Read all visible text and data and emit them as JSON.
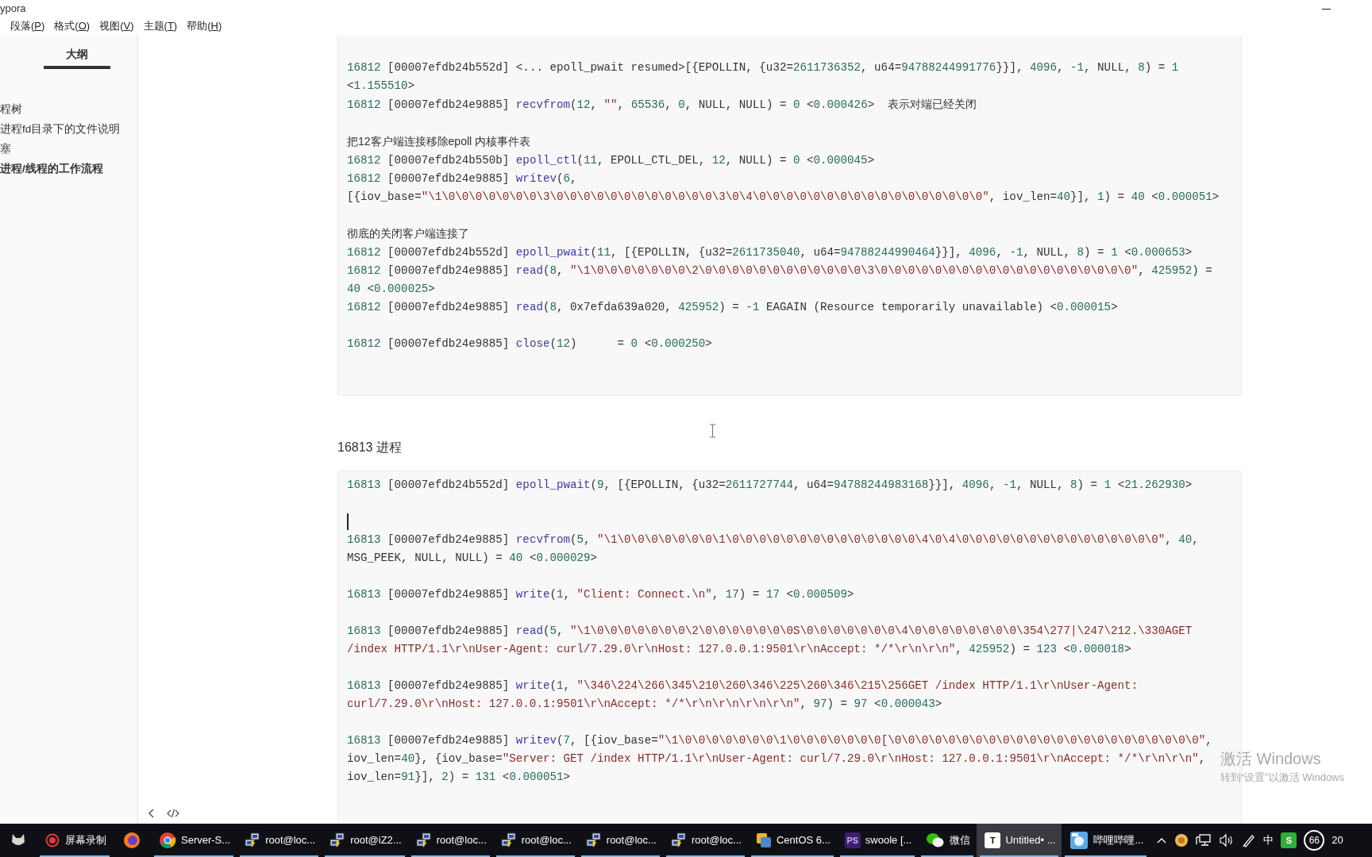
{
  "window": {
    "title": "ypora"
  },
  "menu": [
    {
      "text": "段落(",
      "mnemonic": "P",
      "tail": ")"
    },
    {
      "text": "格式(",
      "mnemonic": "O",
      "tail": ")"
    },
    {
      "text": "视图(",
      "mnemonic": "V",
      "tail": ")"
    },
    {
      "text": "主题(",
      "mnemonic": "T",
      "tail": ")"
    },
    {
      "text": "帮助(",
      "mnemonic": "H",
      "tail": ")"
    }
  ],
  "outline": {
    "title": "大纲",
    "items": [
      {
        "text": "程树",
        "selected": false
      },
      {
        "text": "进程fd目录下的文件说明",
        "selected": false
      },
      {
        "text": "塞",
        "selected": false
      },
      {
        "text": "进程/线程的工作流程",
        "selected": true
      }
    ]
  },
  "document": {
    "blocks": [
      {
        "kind": "code",
        "cut_top": true,
        "groups": [
          {
            "lines": [
              {
                "kind": "code",
                "text": "16812 [00007efdb24b552d] <... epoll_pwait resumed>[{EPOLLIN, {u32=2611736352, u64=94788244991776}}], 4096, -1, NULL, 8) = 1 <1.155510>"
              },
              {
                "kind": "code",
                "text": "16812 [00007efdb24e9885] recvfrom(12, \"\", 65536, 0, NULL, NULL) = 0 <0.000426>",
                "note": "表示对端已经关闭"
              }
            ]
          },
          {
            "lines": [
              {
                "kind": "prose",
                "text": "把12客户端连接移除epoll 内核事件表"
              },
              {
                "kind": "code",
                "text": "16812 [00007efdb24b550b] epoll_ctl(11, EPOLL_CTL_DEL, 12, NULL) = 0 <0.000045>"
              },
              {
                "kind": "code",
                "text": "16812 [00007efdb24e9885] writev(6, [{iov_base=\"\\1\\0\\0\\0\\0\\0\\0\\0\\3\\0\\0\\0\\0\\0\\0\\0\\0\\0\\0\\0\\0\\3\\0\\4\\0\\0\\0\\0\\0\\0\\0\\0\\0\\0\\0\\0\\0\\0\\0\\0\\0\", iov_len=40}], 1) = 40 <0.000051>"
              }
            ]
          },
          {
            "lines": [
              {
                "kind": "prose",
                "text": "彻底的关闭客户端连接了"
              },
              {
                "kind": "code",
                "text": "16812 [00007efdb24b552d] epoll_pwait(11, [{EPOLLIN, {u32=2611735040, u64=94788244990464}}], 4096, -1, NULL, 8) = 1 <0.000653>"
              },
              {
                "kind": "code",
                "text": "16812 [00007efdb24e9885] read(8, \"\\1\\0\\0\\0\\0\\0\\0\\0\\2\\0\\0\\0\\0\\0\\0\\0\\0\\0\\0\\0\\0\\3\\0\\0\\0\\0\\0\\0\\0\\0\\0\\0\\0\\0\\0\\0\\0\\0\\0\\0\\0\", 425952) = 40 <0.000025>"
              },
              {
                "kind": "code",
                "text": "16812 [00007efdb24e9885] read(8, 0x7efda639a020, 425952) = -1 EAGAIN (Resource temporarily unavailable) <0.000015>"
              }
            ]
          },
          {
            "lines": [
              {
                "kind": "code",
                "text": "16812 [00007efdb24e9885] close(12)      = 0 <0.000250>"
              }
            ]
          }
        ]
      },
      {
        "kind": "heading",
        "text": "16813 进程"
      },
      {
        "kind": "code",
        "cut_top": false,
        "groups": [
          {
            "lines": [
              {
                "kind": "code",
                "text": "16813 [00007efdb24b552d] epoll_pwait(9, [{EPOLLIN, {u32=2611727744, u64=94788244983168}}], 4096, -1, NULL, 8) = 1 <21.262930>"
              }
            ]
          },
          {
            "lines": [
              {
                "kind": "cursor"
              },
              {
                "kind": "code",
                "text": "16813 [00007efdb24e9885] recvfrom(5, \"\\1\\0\\0\\0\\0\\0\\0\\0\\1\\0\\0\\0\\0\\0\\0\\0\\0\\0\\0\\0\\0\\0\\0\\4\\0\\4\\0\\0\\0\\0\\0\\0\\0\\0\\0\\0\\0\\0\\0\\0\\0\", 40, MSG_PEEK, NULL, NULL) = 40 <0.000029>"
              }
            ]
          },
          {
            "lines": [
              {
                "kind": "code",
                "text": "16813 [00007efdb24e9885] write(1, \"Client: Connect.\\n\", 17) = 17 <0.000509>"
              }
            ]
          },
          {
            "lines": [
              {
                "kind": "code",
                "text": "16813 [00007efdb24e9885] read(5, \"\\1\\0\\0\\0\\0\\0\\0\\0\\2\\0\\0\\0\\0\\0\\0\\0S\\0\\0\\0\\0\\0\\0\\0\\4\\0\\0\\0\\0\\0\\0\\0\\0\\354\\277|\\247\\212.\\330AGET /index HTTP/1.1\\r\\nUser-Agent: curl/7.29.0\\r\\nHost: 127.0.0.1:9501\\r\\nAccept: */*\\r\\n\\r\\n\", 425952) = 123 <0.000018>"
              }
            ]
          },
          {
            "lines": [
              {
                "kind": "code",
                "text": "16813 [00007efdb24e9885] write(1, \"\\346\\224\\266\\345\\210\\260\\346\\225\\260\\346\\215\\256GET /index HTTP/1.1\\r\\nUser-Agent: curl/7.29.0\\r\\nHost: 127.0.0.1:9501\\r\\nAccept: */*\\r\\n\\r\\n\\r\\n\\r\\n\", 97) = 97 <0.000043>"
              }
            ]
          },
          {
            "lines": [
              {
                "kind": "code",
                "text": "16813 [00007efdb24e9885] writev(7, [{iov_base=\"\\1\\0\\0\\0\\0\\0\\0\\0\\1\\0\\0\\0\\0\\0\\0\\0[\\0\\0\\0\\0\\0\\0\\0\\0\\0\\0\\0\\0\\0\\0\\0\\0\\0\\0\\0\\0\\0\\0\\0\", iov_len=40}, {iov_base=\"Server: GET /index HTTP/1.1\\r\\nUser-Agent: curl/7.29.0\\r\\nHost: 127.0.0.1:9501\\r\\nAccept: */*\\r\\n\\r\\n\", iov_len=91}], 2) = 131 <0.000051>"
              }
            ]
          }
        ]
      }
    ]
  },
  "watermark": {
    "title": "激活 Windows",
    "hint": "转到“设置”以激活 Windows"
  },
  "taskbar": {
    "items": [
      {
        "kind": "cat",
        "running": false,
        "selected": false
      },
      {
        "kind": "record",
        "label": "屏幕录制",
        "running": true,
        "selected": false
      },
      {
        "kind": "firefox",
        "running": false,
        "selected": false
      },
      {
        "kind": "chrome",
        "label": "Server-S...",
        "running": true,
        "selected": false
      },
      {
        "kind": "putty",
        "label": "root@loc...",
        "running": true,
        "selected": false
      },
      {
        "kind": "putty",
        "label": "root@iZ2...",
        "running": true,
        "selected": false
      },
      {
        "kind": "putty",
        "label": "root@loc...",
        "running": true,
        "selected": false
      },
      {
        "kind": "putty",
        "label": "root@loc...",
        "running": true,
        "selected": false
      },
      {
        "kind": "putty",
        "label": "root@loc...",
        "running": true,
        "selected": false
      },
      {
        "kind": "putty",
        "label": "root@loc...",
        "running": true,
        "selected": false
      },
      {
        "kind": "vm",
        "label": "CentOS 6...",
        "running": true,
        "selected": false
      },
      {
        "kind": "ps",
        "badge": "PS",
        "label": "swoole [...",
        "running": true,
        "selected": false
      },
      {
        "kind": "wechat",
        "label": "微信",
        "running": true,
        "selected": false
      },
      {
        "kind": "typora",
        "badge": "T",
        "label": "Untitled• ...",
        "running": true,
        "selected": true
      },
      {
        "kind": "bili",
        "label": "哔哩哔哩...",
        "running": true,
        "selected": false
      }
    ],
    "tray": {
      "ime": "中",
      "app_badge": "S",
      "counter": "66",
      "clock": "20"
    }
  }
}
